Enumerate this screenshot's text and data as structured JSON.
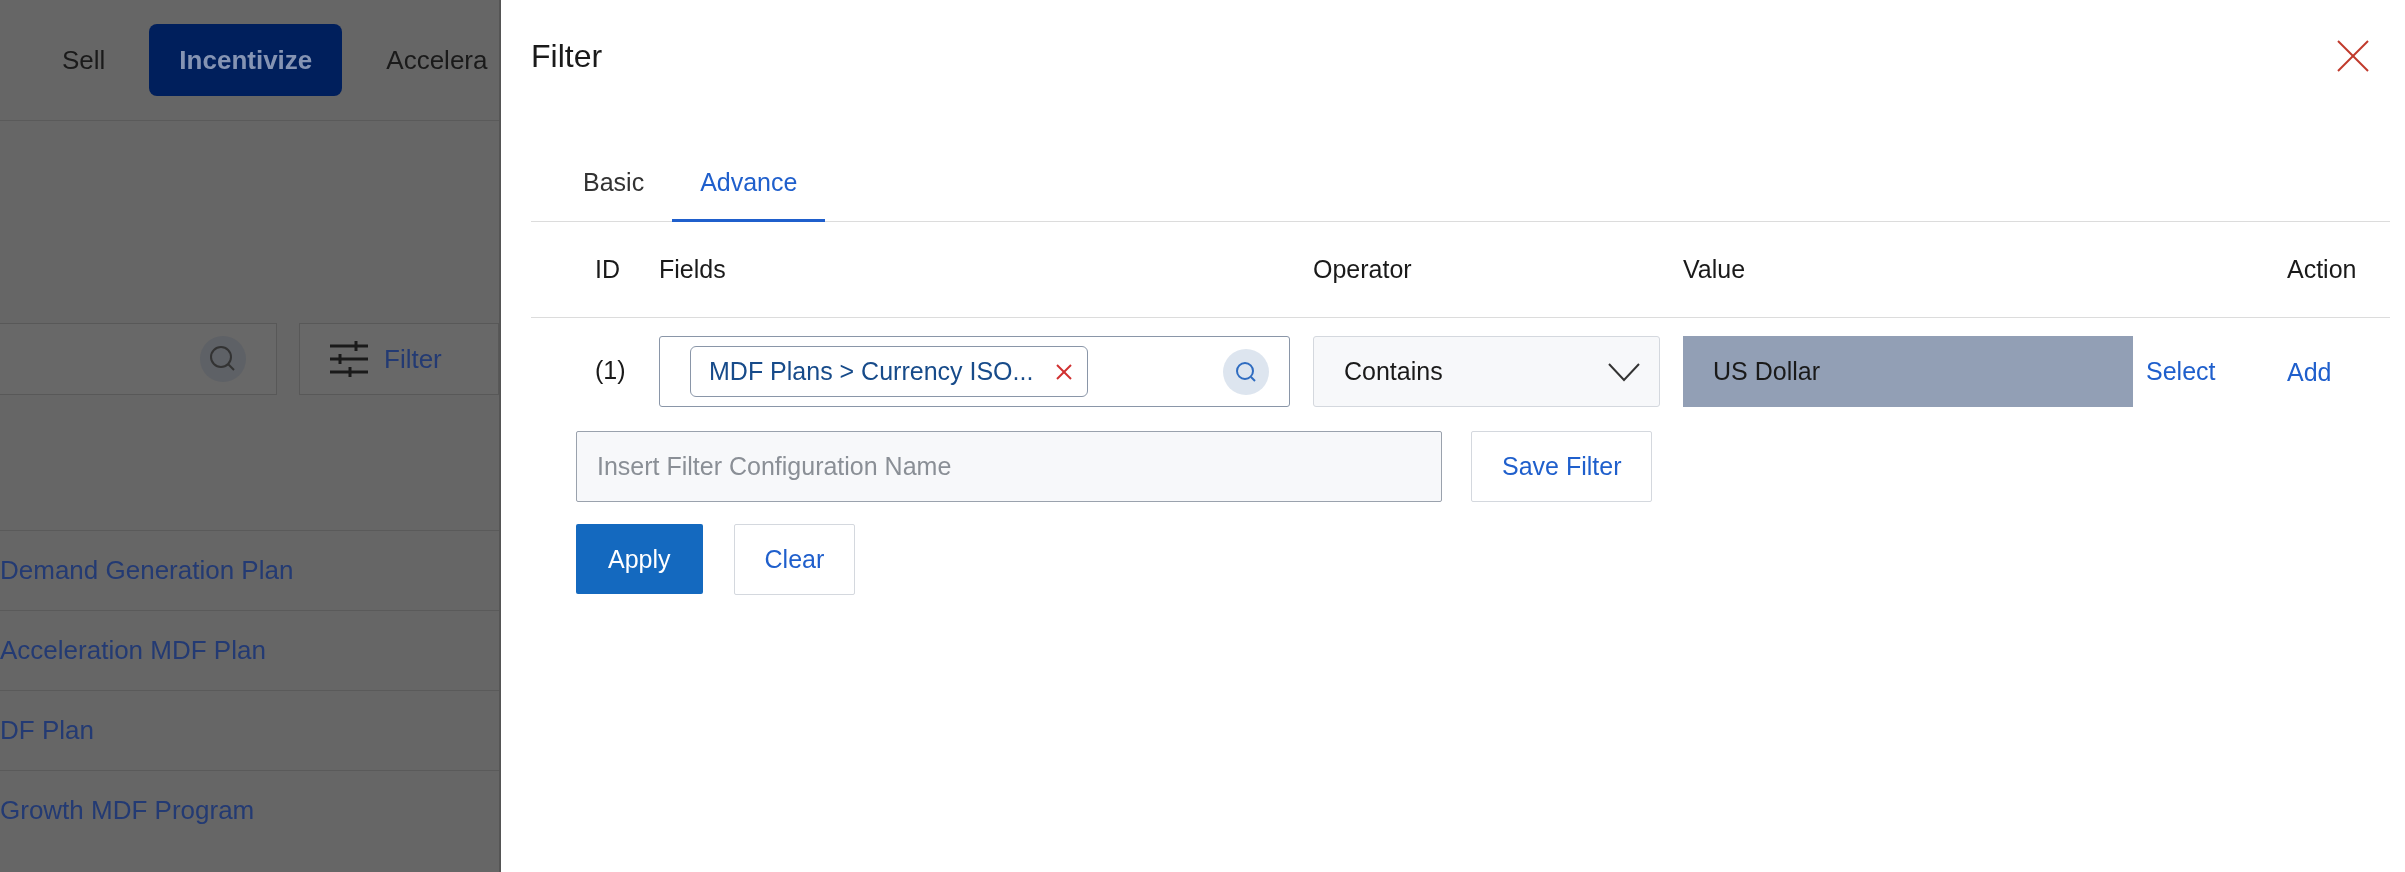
{
  "background_page": {
    "nav_tabs": [
      {
        "label": "Sell",
        "selected": false
      },
      {
        "label": "Incentivize",
        "selected": true
      },
      {
        "label": "Accelera",
        "selected": false
      }
    ],
    "filter_button": {
      "label": "Filter"
    },
    "rows": [
      "Demand Generation Plan",
      "Acceleration MDF Plan",
      "DF Plan",
      "Growth MDF Program"
    ]
  },
  "filter_panel": {
    "title": "Filter",
    "tabs": [
      {
        "label": "Basic",
        "selected": false
      },
      {
        "label": "Advance",
        "selected": true
      }
    ],
    "columns": [
      "ID",
      "Fields",
      "Operator",
      "Value",
      "Action"
    ],
    "conditions": [
      {
        "id": "(1)",
        "field_tag": "MDF Plans > Currency ISO...",
        "operator": "Contains",
        "value": "US Dollar",
        "select_link": "Select",
        "action": "Add"
      }
    ],
    "config_name": {
      "placeholder": "Insert Filter Configuration Name"
    },
    "save_button": "Save Filter",
    "apply_button": "Apply",
    "clear_button": "Clear"
  }
}
